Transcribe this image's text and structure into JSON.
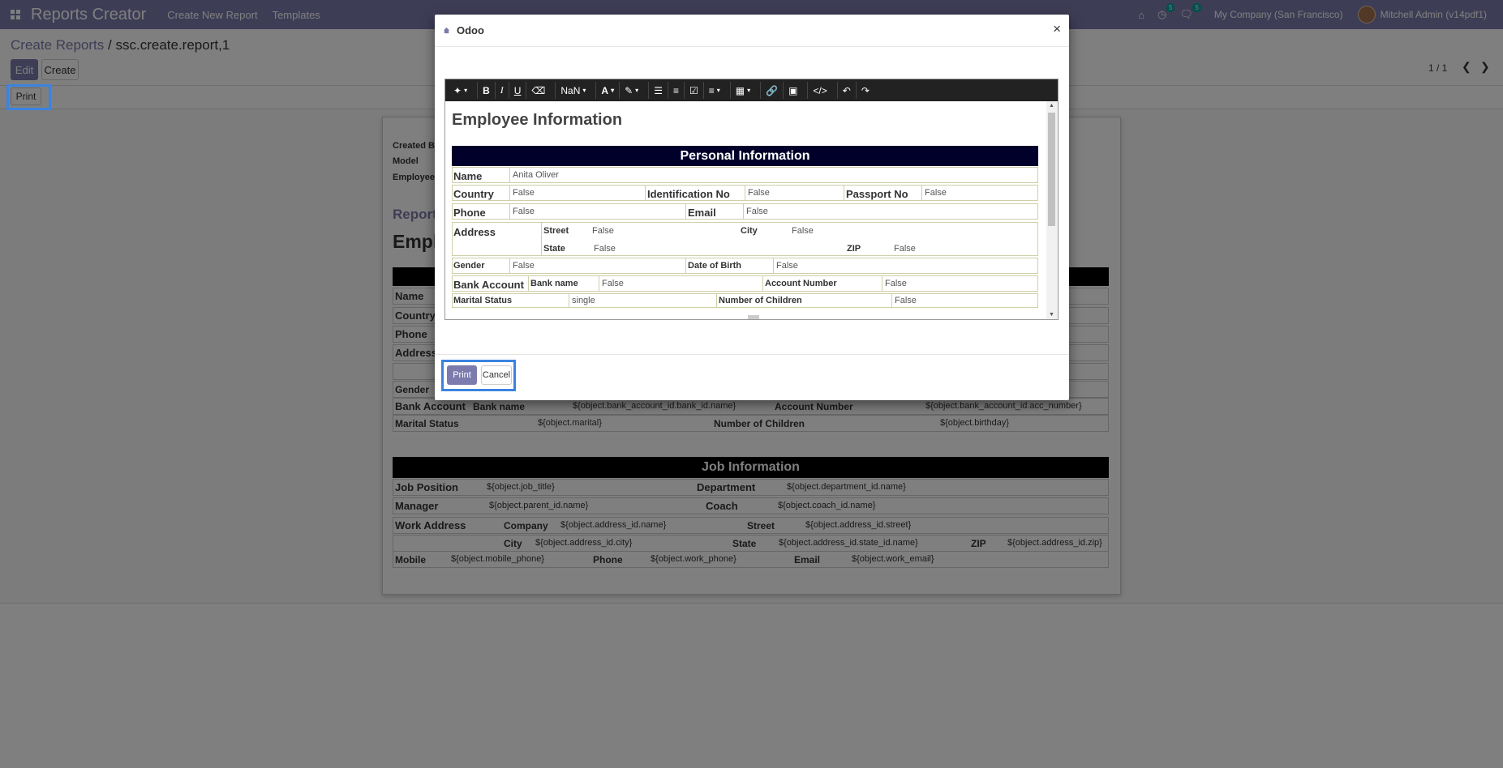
{
  "navbar": {
    "app_name": "Reports Creator",
    "menu": [
      "Create New Report",
      "Templates"
    ],
    "activity_badge": "5",
    "messages_badge": "5",
    "company": "My Company (San Francisco)",
    "user": "Mitchell Admin (v14pdf1)"
  },
  "control_panel": {
    "breadcrumb_parent": "Create Reports",
    "breadcrumb_sep": "/",
    "breadcrumb_current": "ssc.create.report,1",
    "edit_label": "Edit",
    "create_label": "Create",
    "pager": "1 / 1",
    "print_label": "Print"
  },
  "sheet": {
    "field_labels": [
      "Created By",
      "Model",
      "Employee"
    ],
    "subtitle": "Report",
    "heading": "Empl",
    "left_labels": [
      "Name",
      "Country",
      "Phone",
      "Address",
      "",
      "Gender"
    ],
    "bank": {
      "label": "Bank Account",
      "bank_name_label": "Bank name",
      "bank_name": "${object.bank_account_id.bank_id.name}",
      "acc_label": "Account Number",
      "acc": "${object.bank_account_id.acc_number}"
    },
    "marital": {
      "label": "Marital Status",
      "value": "${object.marital}",
      "children_label": "Number of Children",
      "children": "${object.birthday}"
    },
    "job_title": "Job Information",
    "job_position_label": "Job Position",
    "job_position": "${object.job_title}",
    "department_label": "Department",
    "department": "${object.department_id.name}",
    "manager_label": "Manager",
    "manager": "${object.parent_id.name}",
    "coach_label": "Coach",
    "coach": "${object.coach_id.name}",
    "work_address_label": "Work Address",
    "company_label": "Company",
    "company": "${object.address_id.name}",
    "street_label": "Street",
    "street": "${object.address_id.street}",
    "city_label": "City",
    "city": "${object.address_id.city}",
    "state_label": "State",
    "state": "${object.address_id.state_id.name}",
    "zip_label": "ZIP",
    "zip": "${object.address_id.zip}",
    "mobile_label": "Mobile",
    "mobile": "${object.mobile_phone}",
    "phone_label": "Phone",
    "phone": "${object.work_phone}",
    "email_label": "Email",
    "email": "${object.work_email}"
  },
  "modal": {
    "title": "Odoo",
    "close": "×",
    "toolbar": {
      "font_size": "NaN"
    },
    "editor": {
      "heading": "Employee Information",
      "section": "Personal Information",
      "name_label": "Name",
      "name": "Anita Oliver",
      "country_label": "Country",
      "country": "False",
      "id_label": "Identification No",
      "id": "False",
      "passport_label": "Passport No",
      "passport": "False",
      "phone_label": "Phone",
      "phone": "False",
      "email_label": "Email",
      "email": "False",
      "address_label": "Address",
      "street_label": "Street",
      "street": "False",
      "city_label": "City",
      "city": "False",
      "state_label": "State",
      "state": "False",
      "zip_label": "ZIP",
      "zip": "False",
      "gender_label": "Gender",
      "gender": "False",
      "dob_label": "Date of Birth",
      "dob": "False",
      "bank_label": "Bank Account",
      "bank_name_label": "Bank name",
      "bank_name": "False",
      "acc_label": "Account Number",
      "acc": "False",
      "marital_label": "Marital Status",
      "marital": "single",
      "children_label": "Number of Children",
      "children": "False"
    },
    "print_label": "Print",
    "cancel_label": "Cancel"
  }
}
